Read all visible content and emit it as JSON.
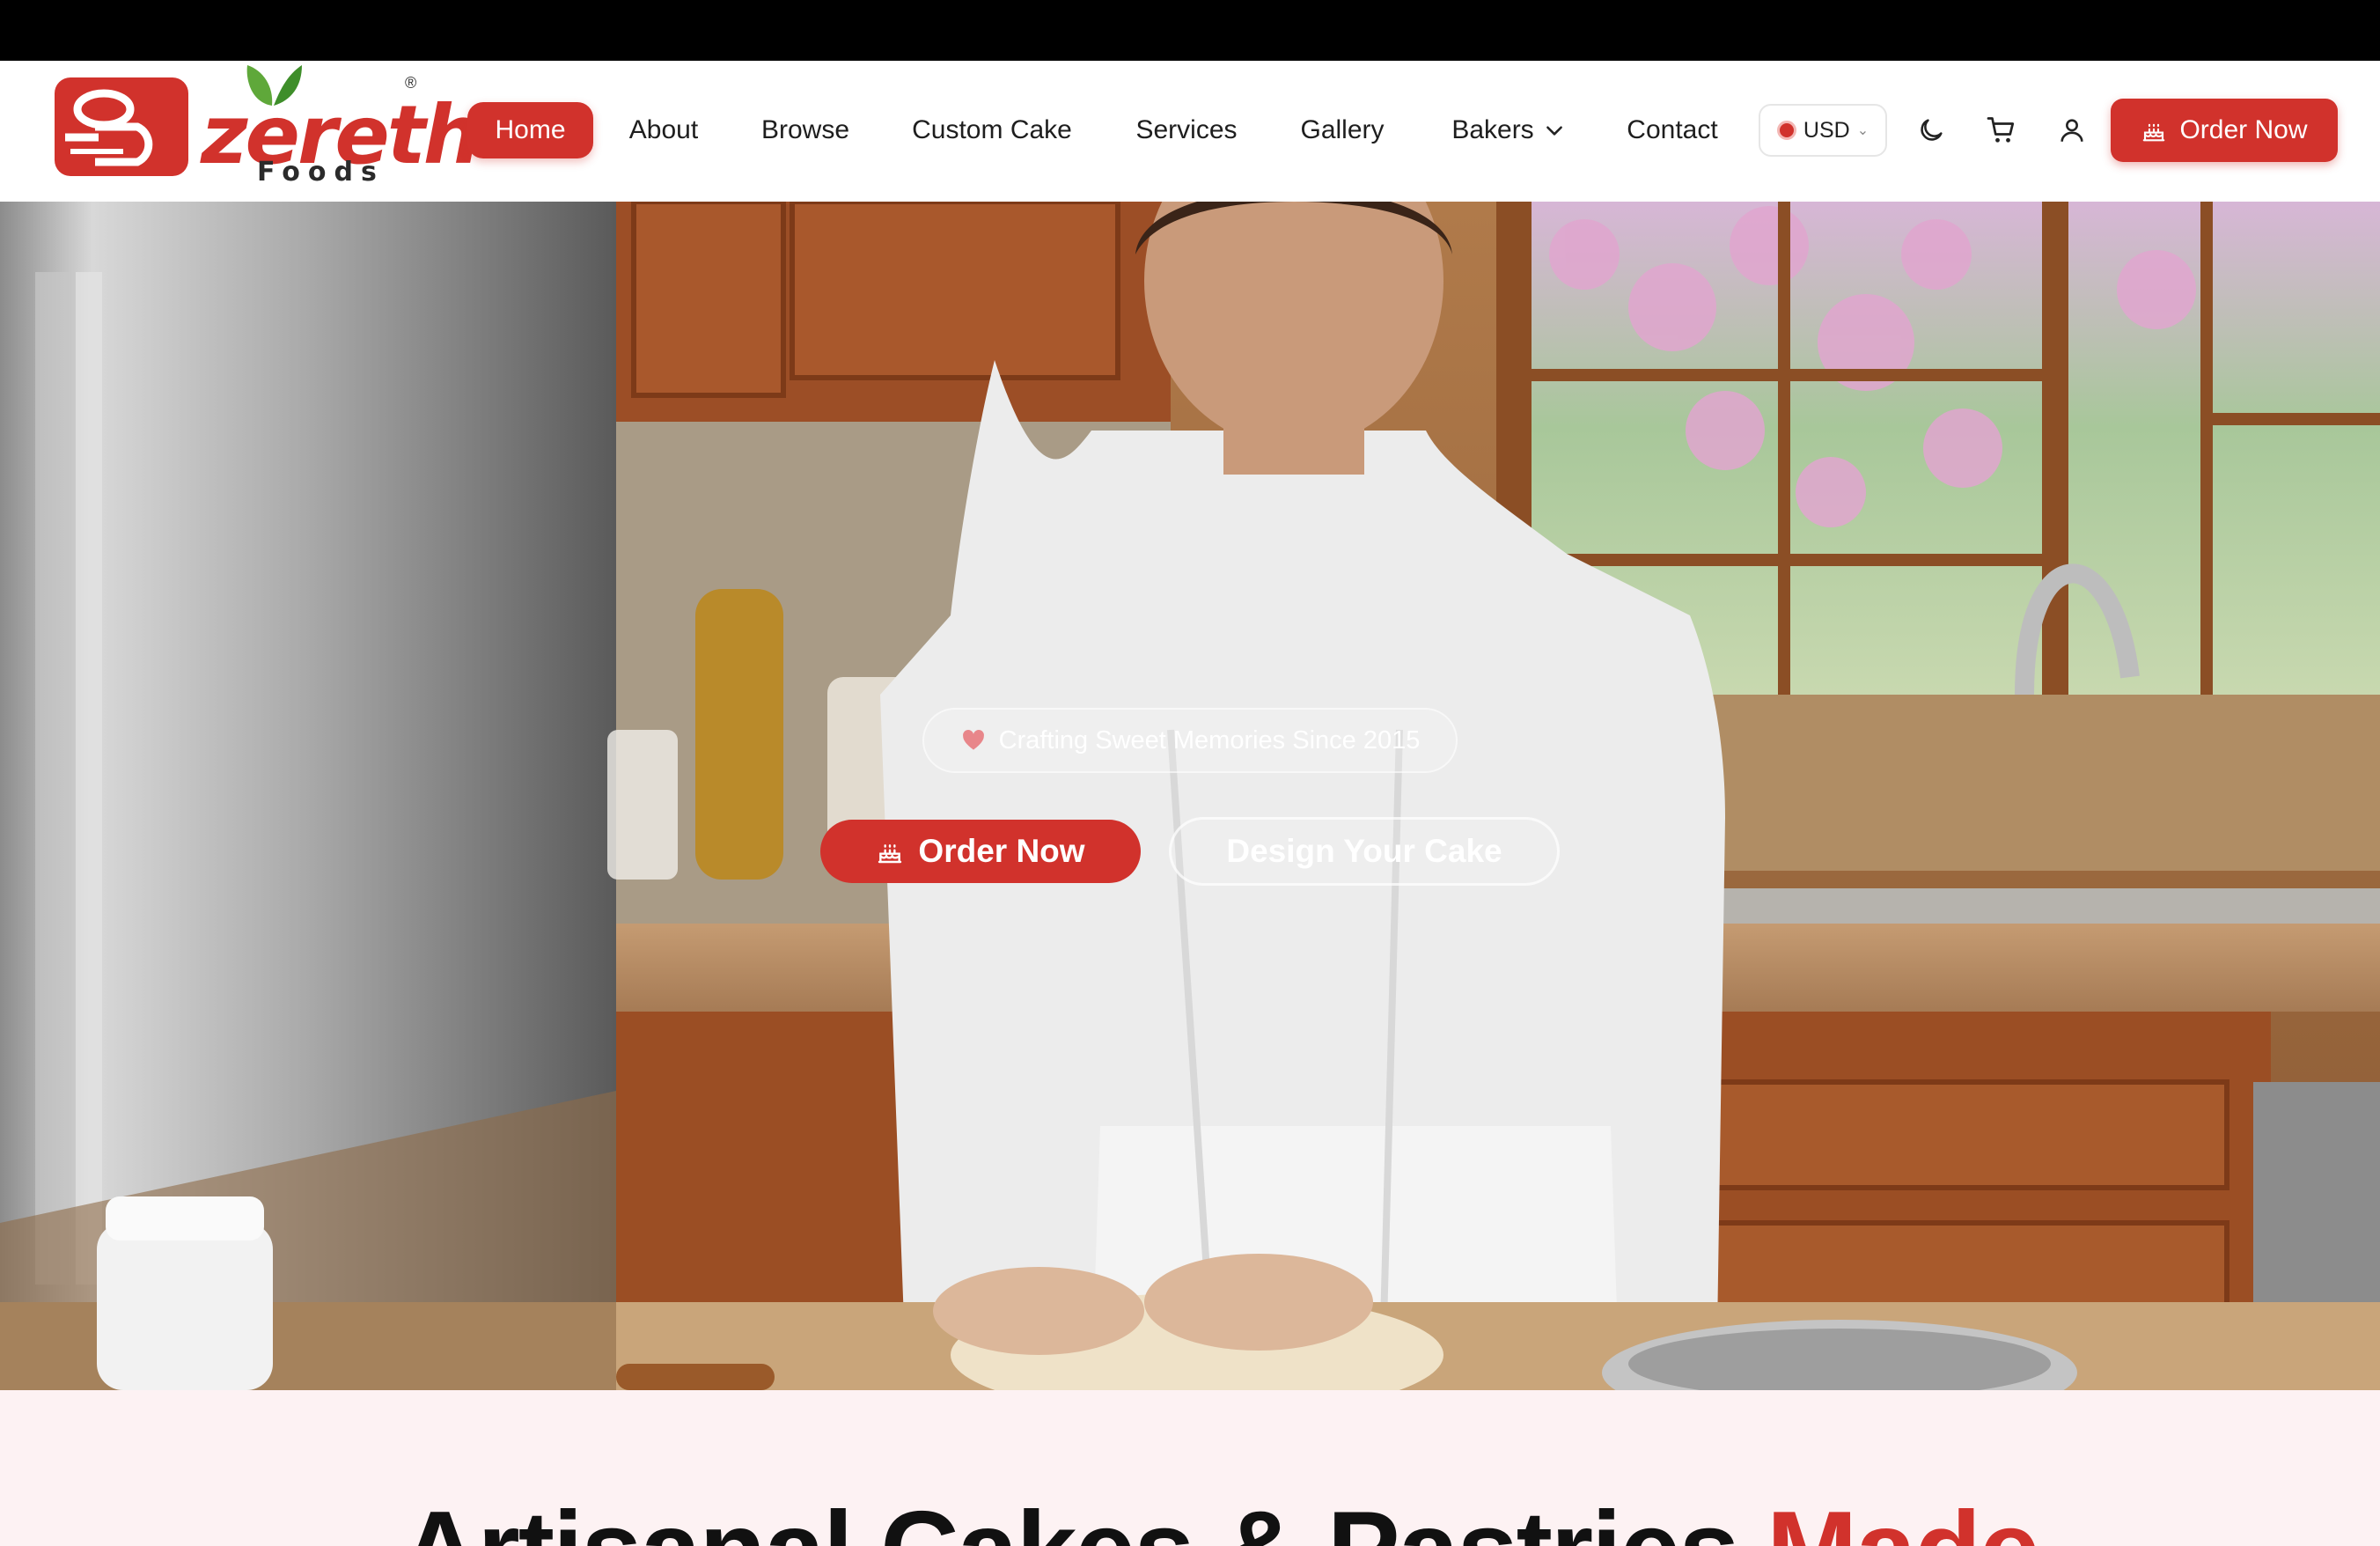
{
  "brand": {
    "name": "zereth",
    "sub": "Foods",
    "reg": "®",
    "accent": "#d1322c"
  },
  "nav": {
    "items": [
      {
        "label": "Home",
        "active": true
      },
      {
        "label": "About"
      },
      {
        "label": "Browse"
      },
      {
        "label": "Custom Cake"
      },
      {
        "label": "Services"
      },
      {
        "label": "Gallery"
      },
      {
        "label": "Bakers"
      },
      {
        "label": "Contact"
      }
    ],
    "currency": "USD",
    "order_label": "Order Now",
    "icons": [
      "moon-icon",
      "cart-icon",
      "user-icon"
    ]
  },
  "hero": {
    "badge": "Crafting Sweet Memories Since 2015",
    "order_label": "Order Now",
    "design_label": "Design Your Cake"
  },
  "headline": {
    "main": "Artisanal Cakes & Pastries ",
    "accent": "Made"
  }
}
